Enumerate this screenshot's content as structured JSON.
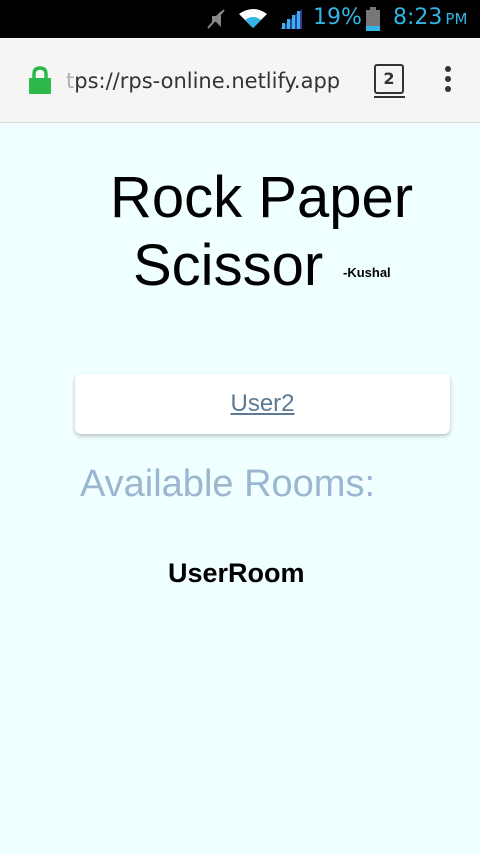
{
  "status_bar": {
    "battery_percent": "19%",
    "time": "8:23",
    "ampm": "PM",
    "accent_color": "#33b5e5",
    "icons": [
      "mute-icon",
      "wifi-icon",
      "signal-icon",
      "battery-icon"
    ]
  },
  "browser": {
    "url_faded": "t",
    "url_text": "ps://rps-online.netlify.app",
    "tab_count": "2",
    "lock_color": "#2db84a"
  },
  "app": {
    "title_line1": "Rock Paper",
    "title_line2": "Scissor",
    "author": "-Kushal",
    "user_name": "User2",
    "rooms_heading": "Available Rooms:",
    "rooms": [
      "UserRoom"
    ],
    "background_color": "#f0ffff",
    "heading_color": "#9ab6d0",
    "link_color": "#5a7a95"
  }
}
